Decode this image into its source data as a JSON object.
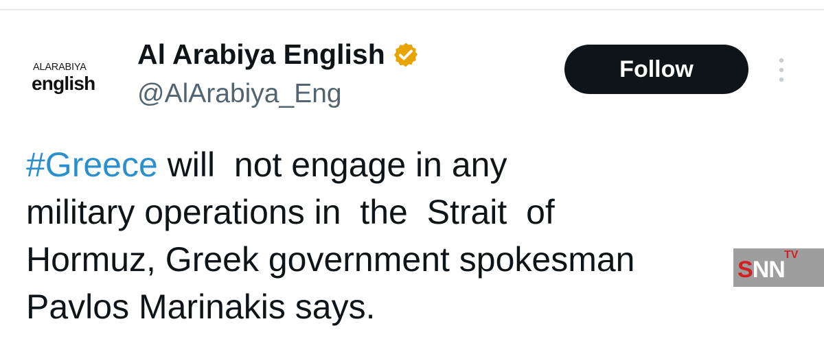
{
  "profile": {
    "avatar_line1": "ALARABIYA",
    "avatar_line2": "english",
    "display_name": "Al Arabiya English",
    "handle": "@AlArabiya_Eng",
    "verified_icon": "gold-verified-badge-icon",
    "verified_color": "#e8a400"
  },
  "actions": {
    "follow_label": "Follow",
    "more_icon": "vertical-dots-icon"
  },
  "tweet": {
    "hashtag": "#Greece",
    "text": " will  not engage in any\nmilitary operations in  the  Strait  of\nHormuz, Greek government spokesman\nPavlos Marinakis says.",
    "hashtag_color": "#2b8fcf"
  },
  "watermark": {
    "brand_s": "S",
    "brand_nn": "NN",
    "brand_tv": "TV"
  }
}
